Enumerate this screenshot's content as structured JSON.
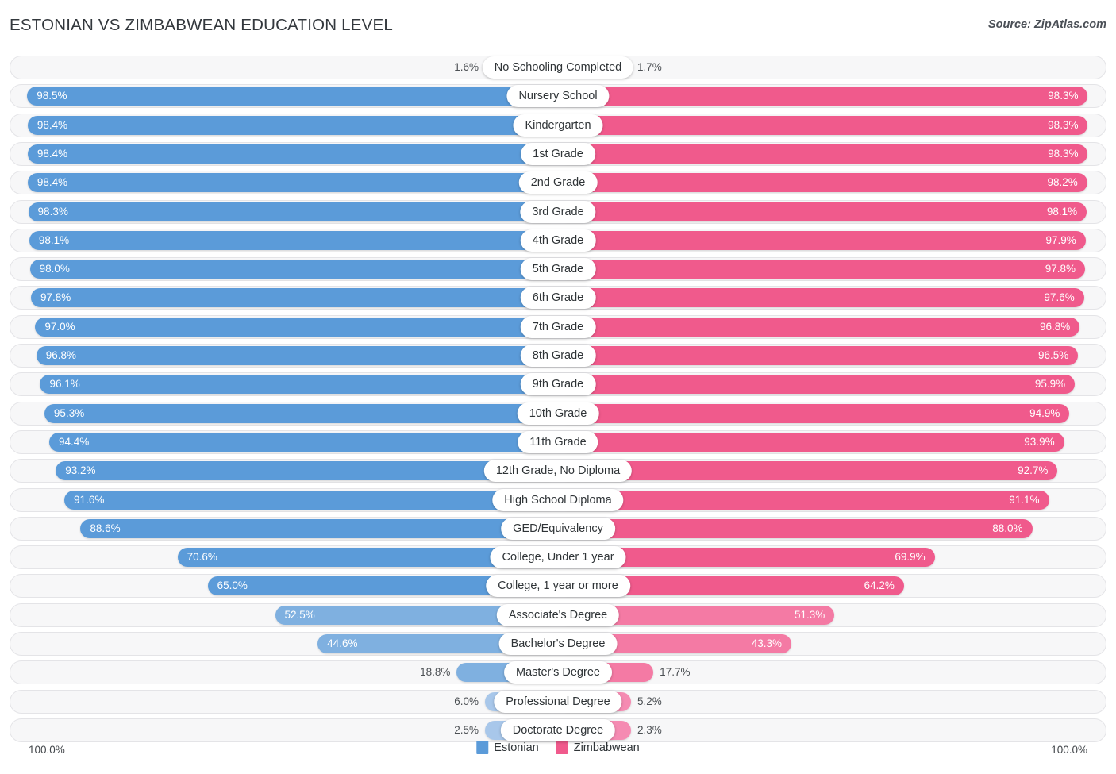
{
  "header": {
    "title": "ESTONIAN VS ZIMBABWEAN EDUCATION LEVEL",
    "source": "Source: ZipAtlas.com"
  },
  "footer": {
    "axis_min_label": "100.0%",
    "axis_max_label": "100.0%",
    "legend": [
      {
        "label": "Estonian",
        "color": "#5b9bd9"
      },
      {
        "label": "Zimbabwean",
        "color": "#f05a8c"
      }
    ]
  },
  "colors": {
    "estonian_strong": "#5b9bd9",
    "estonian_light": "#a8c7ea",
    "zimbabwean_strong": "#f05a8c",
    "zimbabwean_light": "#f58bb2",
    "track": "#f7f7f8",
    "track_border": "#e4e4e7"
  },
  "chart_data": {
    "type": "bar",
    "title": "ESTONIAN VS ZIMBABWEAN EDUCATION LEVEL",
    "subtitle": "",
    "xlabel": "",
    "ylabel": "",
    "orientation": "horizontal-diverging",
    "grid": false,
    "legend_position": "bottom-center",
    "axis_max": 100.0,
    "unit": "%",
    "categories": [
      "No Schooling Completed",
      "Nursery School",
      "Kindergarten",
      "1st Grade",
      "2nd Grade",
      "3rd Grade",
      "4th Grade",
      "5th Grade",
      "6th Grade",
      "7th Grade",
      "8th Grade",
      "9th Grade",
      "10th Grade",
      "11th Grade",
      "12th Grade, No Diploma",
      "High School Diploma",
      "GED/Equivalency",
      "College, Under 1 year",
      "College, 1 year or more",
      "Associate's Degree",
      "Bachelor's Degree",
      "Master's Degree",
      "Professional Degree",
      "Doctorate Degree"
    ],
    "series": [
      {
        "name": "Estonian",
        "color": "#5b9bd9",
        "values": [
          1.6,
          98.5,
          98.4,
          98.4,
          98.4,
          98.3,
          98.1,
          98.0,
          97.8,
          97.0,
          96.8,
          96.1,
          95.3,
          94.4,
          93.2,
          91.6,
          88.6,
          70.6,
          65.0,
          52.5,
          44.6,
          18.8,
          6.0,
          2.5
        ]
      },
      {
        "name": "Zimbabwean",
        "color": "#f05a8c",
        "values": [
          1.7,
          98.3,
          98.3,
          98.3,
          98.2,
          98.1,
          97.9,
          97.8,
          97.6,
          96.8,
          96.5,
          95.9,
          94.9,
          93.9,
          92.7,
          91.1,
          88.0,
          69.9,
          64.2,
          51.3,
          43.3,
          17.7,
          5.2,
          2.3
        ]
      }
    ],
    "rows": [
      {
        "label": "No Schooling Completed",
        "left_value": 1.6,
        "left_text": "1.6%",
        "right_value": 1.7,
        "right_text": "1.7%",
        "shade": "light"
      },
      {
        "label": "Nursery School",
        "left_value": 98.5,
        "left_text": "98.5%",
        "right_value": 98.3,
        "right_text": "98.3%",
        "shade": "strong"
      },
      {
        "label": "Kindergarten",
        "left_value": 98.4,
        "left_text": "98.4%",
        "right_value": 98.3,
        "right_text": "98.3%",
        "shade": "strong"
      },
      {
        "label": "1st Grade",
        "left_value": 98.4,
        "left_text": "98.4%",
        "right_value": 98.3,
        "right_text": "98.3%",
        "shade": "strong"
      },
      {
        "label": "2nd Grade",
        "left_value": 98.4,
        "left_text": "98.4%",
        "right_value": 98.2,
        "right_text": "98.2%",
        "shade": "strong"
      },
      {
        "label": "3rd Grade",
        "left_value": 98.3,
        "left_text": "98.3%",
        "right_value": 98.1,
        "right_text": "98.1%",
        "shade": "strong"
      },
      {
        "label": "4th Grade",
        "left_value": 98.1,
        "left_text": "98.1%",
        "right_value": 97.9,
        "right_text": "97.9%",
        "shade": "strong"
      },
      {
        "label": "5th Grade",
        "left_value": 98.0,
        "left_text": "98.0%",
        "right_value": 97.8,
        "right_text": "97.8%",
        "shade": "strong"
      },
      {
        "label": "6th Grade",
        "left_value": 97.8,
        "left_text": "97.8%",
        "right_value": 97.6,
        "right_text": "97.6%",
        "shade": "strong"
      },
      {
        "label": "7th Grade",
        "left_value": 97.0,
        "left_text": "97.0%",
        "right_value": 96.8,
        "right_text": "96.8%",
        "shade": "strong"
      },
      {
        "label": "8th Grade",
        "left_value": 96.8,
        "left_text": "96.8%",
        "right_value": 96.5,
        "right_text": "96.5%",
        "shade": "strong"
      },
      {
        "label": "9th Grade",
        "left_value": 96.1,
        "left_text": "96.1%",
        "right_value": 95.9,
        "right_text": "95.9%",
        "shade": "strong"
      },
      {
        "label": "10th Grade",
        "left_value": 95.3,
        "left_text": "95.3%",
        "right_value": 94.9,
        "right_text": "94.9%",
        "shade": "strong"
      },
      {
        "label": "11th Grade",
        "left_value": 94.4,
        "left_text": "94.4%",
        "right_value": 93.9,
        "right_text": "93.9%",
        "shade": "strong"
      },
      {
        "label": "12th Grade, No Diploma",
        "left_value": 93.2,
        "left_text": "93.2%",
        "right_value": 92.7,
        "right_text": "92.7%",
        "shade": "strong"
      },
      {
        "label": "High School Diploma",
        "left_value": 91.6,
        "left_text": "91.6%",
        "right_value": 91.1,
        "right_text": "91.1%",
        "shade": "strong"
      },
      {
        "label": "GED/Equivalency",
        "left_value": 88.6,
        "left_text": "88.6%",
        "right_value": 88.0,
        "right_text": "88.0%",
        "shade": "strong"
      },
      {
        "label": "College, Under 1 year",
        "left_value": 70.6,
        "left_text": "70.6%",
        "right_value": 69.9,
        "right_text": "69.9%",
        "shade": "strong"
      },
      {
        "label": "College, 1 year or more",
        "left_value": 65.0,
        "left_text": "65.0%",
        "right_value": 64.2,
        "right_text": "64.2%",
        "shade": "strong"
      },
      {
        "label": "Associate's Degree",
        "left_value": 52.5,
        "left_text": "52.5%",
        "right_value": 51.3,
        "right_text": "51.3%",
        "shade": "mid"
      },
      {
        "label": "Bachelor's Degree",
        "left_value": 44.6,
        "left_text": "44.6%",
        "right_value": 43.3,
        "right_text": "43.3%",
        "shade": "mid"
      },
      {
        "label": "Master's Degree",
        "left_value": 18.8,
        "left_text": "18.8%",
        "right_value": 17.7,
        "right_text": "17.7%",
        "shade": "mid"
      },
      {
        "label": "Professional Degree",
        "left_value": 6.0,
        "left_text": "6.0%",
        "right_value": 5.2,
        "right_text": "5.2%",
        "shade": "light"
      },
      {
        "label": "Doctorate Degree",
        "left_value": 2.5,
        "left_text": "2.5%",
        "right_value": 2.3,
        "right_text": "2.3%",
        "shade": "light"
      }
    ]
  }
}
